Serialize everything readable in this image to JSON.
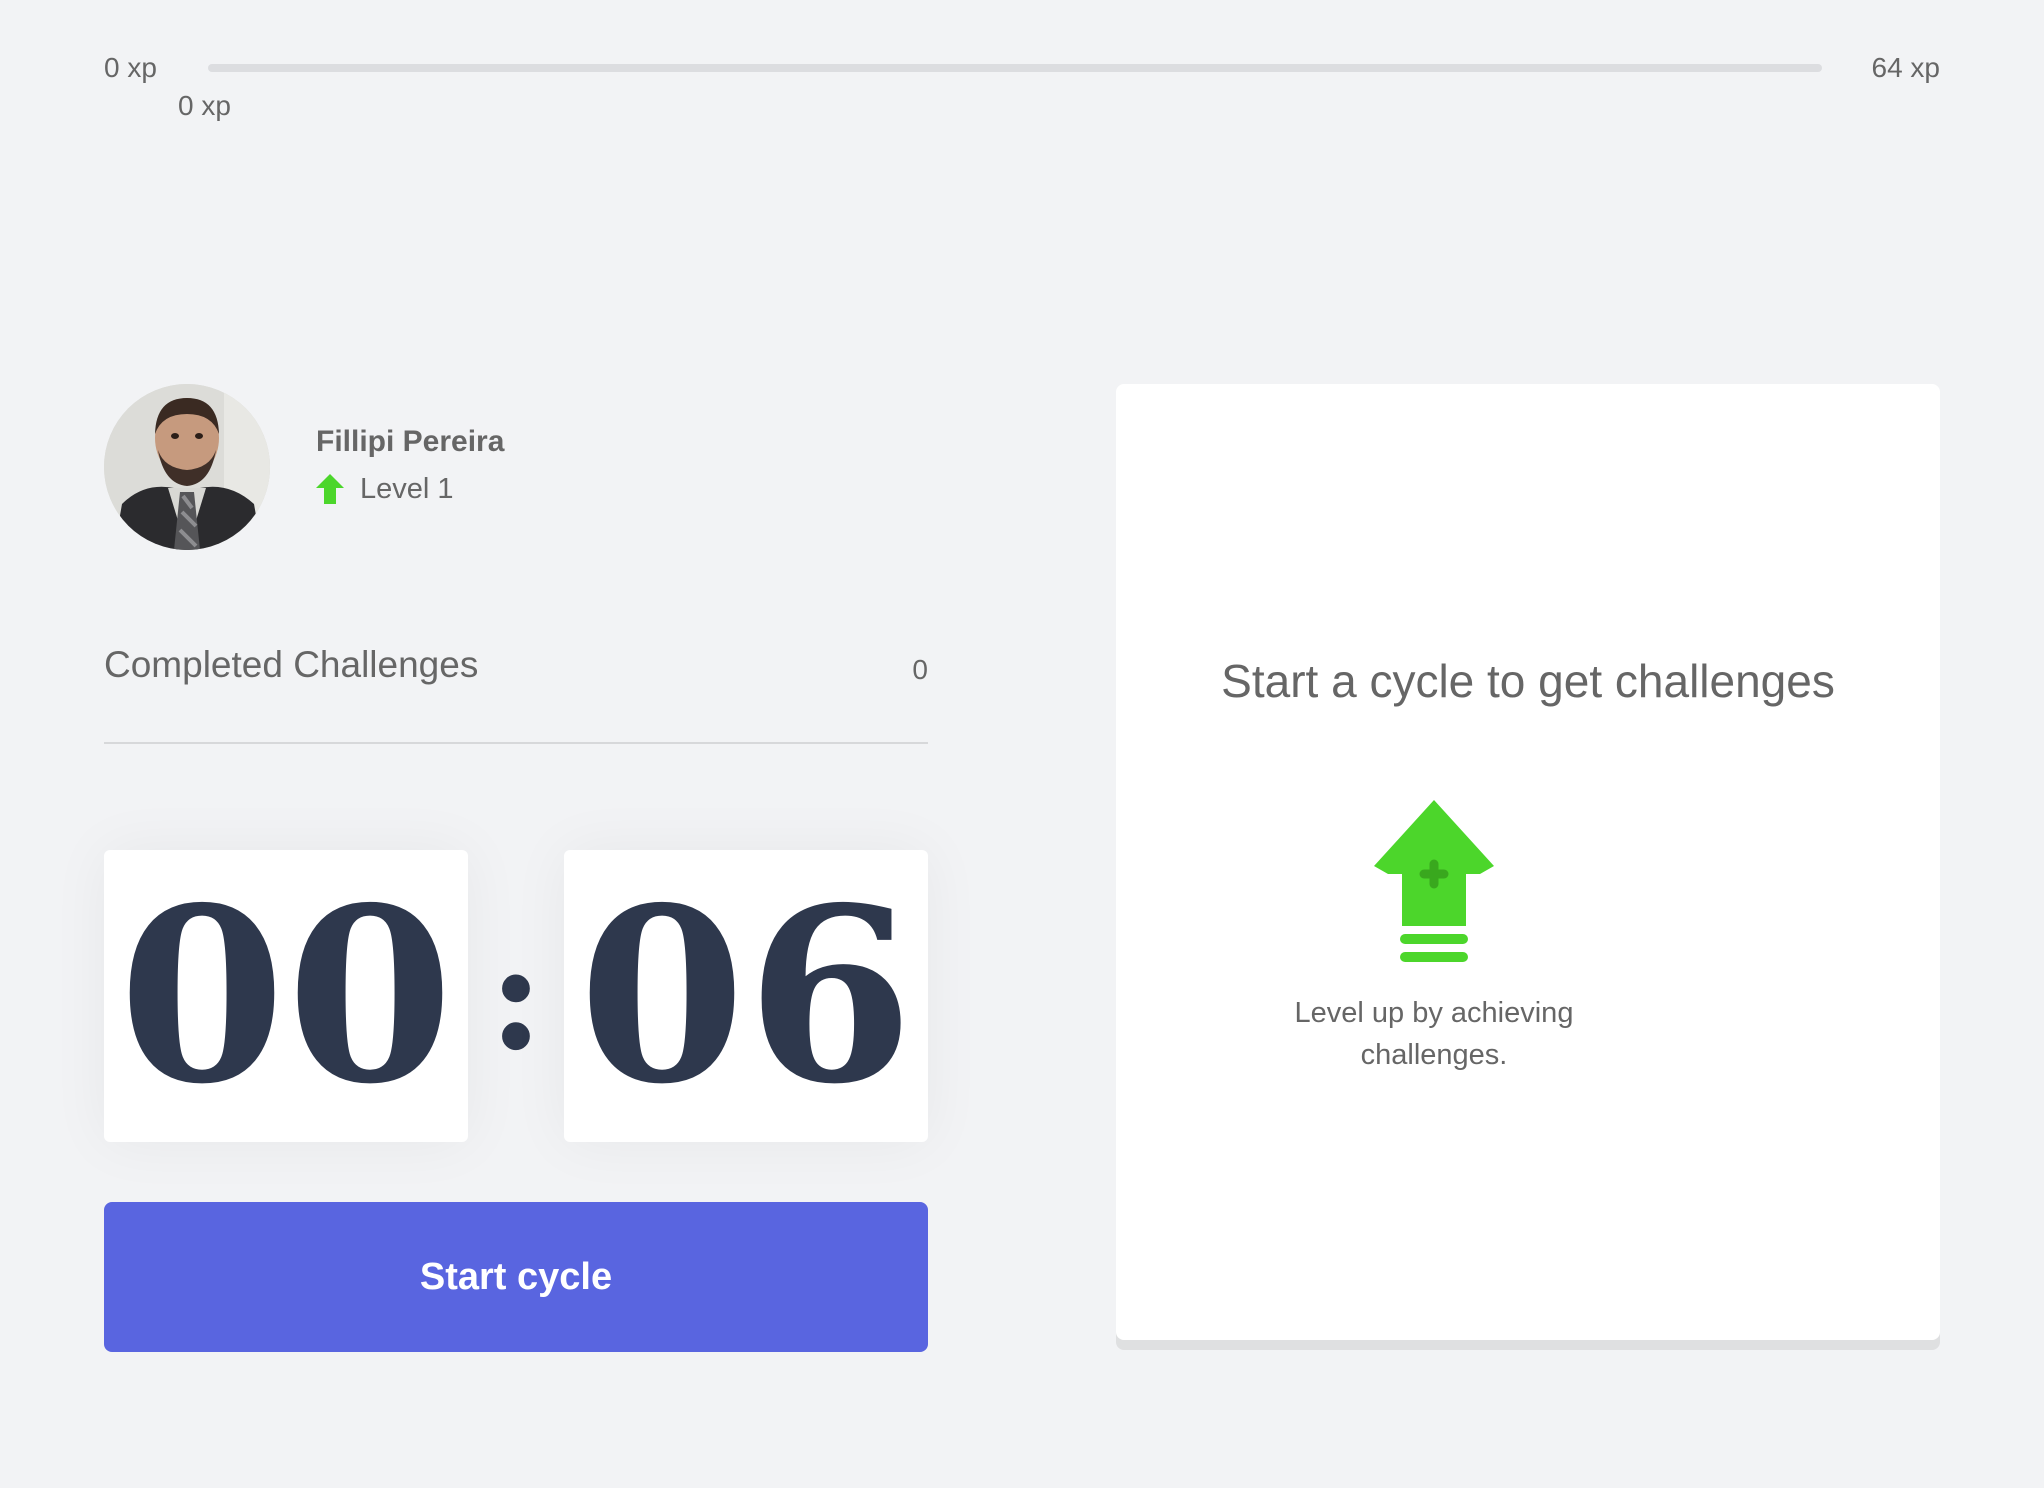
{
  "xp": {
    "min_label": "0 xp",
    "max_label": "64 xp",
    "current_label": "0 xp",
    "progress": 0
  },
  "profile": {
    "name": "Fillipi Pereira",
    "level_label": "Level 1",
    "level_icon": "level-up-arrow-icon",
    "avatar": "profile-photo"
  },
  "completed": {
    "label": "Completed Challenges",
    "count": "0"
  },
  "countdown": {
    "minute_left": "0",
    "minute_right": "0",
    "separator": ":",
    "second_left": "0",
    "second_right": "6"
  },
  "actions": {
    "start_label": "Start cycle"
  },
  "challenge": {
    "title": "Start a cycle to get challenges",
    "hint": "Level up by achieving challenges.",
    "icon": "level-up-icon"
  },
  "colors": {
    "background": "#f2f3f5",
    "accent": "#5965e0",
    "green": "#4cd62b",
    "digits": "#2e384d",
    "text": "#666666"
  }
}
